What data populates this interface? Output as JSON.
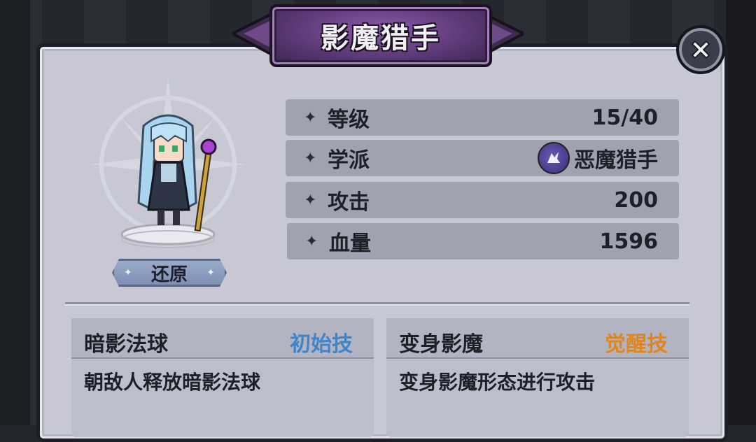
{
  "title": "影魔猎手",
  "close_icon": "close-x-icon",
  "character": {
    "restore_label": "还原"
  },
  "stats": [
    {
      "label": "等级",
      "value": "15/40"
    },
    {
      "label": "学派",
      "value": "恶魔猎手",
      "icon": "demon-hunter-school-icon"
    },
    {
      "label": "攻击",
      "value": "200"
    },
    {
      "label": "血量",
      "value": "1596"
    }
  ],
  "skills": [
    {
      "name": "暗影法球",
      "type": "初始技",
      "type_color": "#3f86c9",
      "desc": "朝敌人释放暗影法球"
    },
    {
      "name": "变身影魔",
      "type": "觉醒技",
      "type_color": "#e0861e",
      "desc": "变身影魔形态进行攻击"
    }
  ],
  "colors": {
    "panel": "#c7c8d4",
    "banner": "#5d3a78",
    "stat_row": "#a1a2b0"
  }
}
